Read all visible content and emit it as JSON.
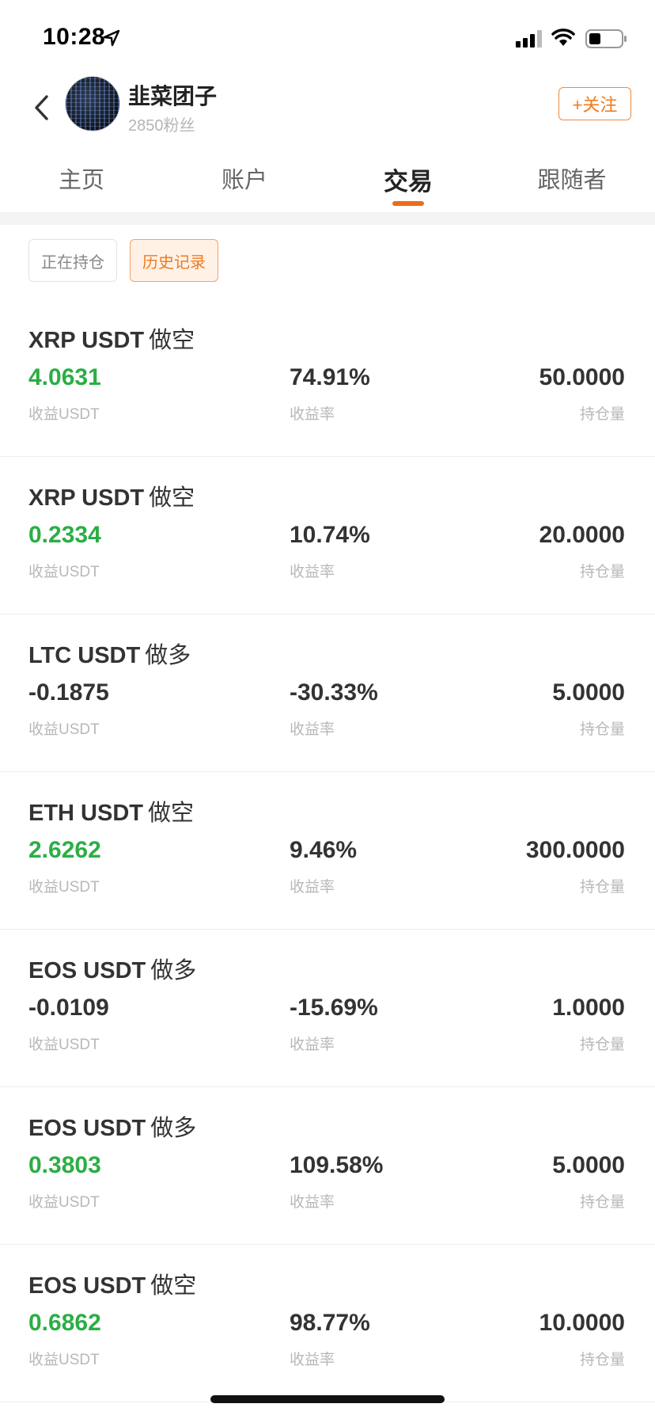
{
  "status_bar": {
    "time": "10:28"
  },
  "header": {
    "username": "韭菜团子",
    "fans": "2850粉丝",
    "follow_label": "+关注"
  },
  "tabs": [
    {
      "label": "主页",
      "active": false
    },
    {
      "label": "账户",
      "active": false
    },
    {
      "label": "交易",
      "active": true
    },
    {
      "label": "跟随者",
      "active": false
    }
  ],
  "filters": [
    {
      "label": "正在持仓",
      "selected": false
    },
    {
      "label": "历史记录",
      "selected": true
    }
  ],
  "labels": {
    "profit": "收益USDT",
    "rate": "收益率",
    "qty": "持仓量"
  },
  "colors": {
    "accent": "#ef7a1c",
    "profit_positive": "#2bae45",
    "text_primary": "#333333"
  },
  "trades": [
    {
      "pair": "XRP USDT",
      "direction": "做空",
      "profit": "4.0631",
      "rate": "74.91%",
      "qty": "50.0000",
      "positive": true
    },
    {
      "pair": "XRP USDT",
      "direction": "做空",
      "profit": "0.2334",
      "rate": "10.74%",
      "qty": "20.0000",
      "positive": true
    },
    {
      "pair": "LTC USDT",
      "direction": "做多",
      "profit": "-0.1875",
      "rate": "-30.33%",
      "qty": "5.0000",
      "positive": false
    },
    {
      "pair": "ETH USDT",
      "direction": "做空",
      "profit": "2.6262",
      "rate": "9.46%",
      "qty": "300.0000",
      "positive": true
    },
    {
      "pair": "EOS USDT",
      "direction": "做多",
      "profit": "-0.0109",
      "rate": "-15.69%",
      "qty": "1.0000",
      "positive": false
    },
    {
      "pair": "EOS USDT",
      "direction": "做多",
      "profit": "0.3803",
      "rate": "109.58%",
      "qty": "5.0000",
      "positive": true
    },
    {
      "pair": "EOS USDT",
      "direction": "做空",
      "profit": "0.6862",
      "rate": "98.77%",
      "qty": "10.0000",
      "positive": true
    }
  ]
}
